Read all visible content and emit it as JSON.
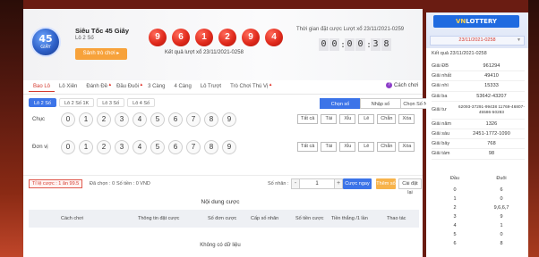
{
  "game": {
    "logo_number": "45",
    "logo_text": "GIÂY",
    "title": "Siêu Tốc 45 Giây",
    "subtitle": "Lô 2 Số",
    "rules_button": "Sảnh trò chơi ▸"
  },
  "result": {
    "balls": [
      "9",
      "6",
      "1",
      "2",
      "9",
      "4"
    ],
    "label": "Kết quả lượt xổ 23/11/2021-0258"
  },
  "countdown": {
    "label": "Thời gian đặt cược Lượt xổ 23/11/2021-0259",
    "h1": "0",
    "h2": "0",
    "m1": "0",
    "m2": "0",
    "s1": "3",
    "s2": "8"
  },
  "category_tabs": [
    {
      "label": "Bao Lô",
      "active": true,
      "hot": false
    },
    {
      "label": "Lô Xiên",
      "hot": false
    },
    {
      "label": "Đánh Đề",
      "hot": true
    },
    {
      "label": "Đầu Đuôi",
      "hot": true
    },
    {
      "label": "3 Càng",
      "hot": false
    },
    {
      "label": "4 Càng",
      "hot": false
    },
    {
      "label": "Lô Trượt",
      "hot": false
    },
    {
      "label": "Trò Chơi Thú Vị",
      "hot": true
    }
  ],
  "guide_label": "Cách chơi",
  "sub_tabs": [
    "Lô 2 Số",
    "Lô 2 Số 1K",
    "Lô 3 Số",
    "Lô 4 Số"
  ],
  "mode_tabs": [
    "Chọn số",
    "Nhập số",
    "Chọn Số Nhanh"
  ],
  "rows": [
    {
      "label": "Chục"
    },
    {
      "label": "Đơn vị"
    }
  ],
  "digits": [
    "0",
    "1",
    "2",
    "3",
    "4",
    "5",
    "6",
    "7",
    "8",
    "9"
  ],
  "quick_buttons": [
    "Tất cả",
    "Tài",
    "Xỉu",
    "Lẻ",
    "Chẵn",
    "Xóa"
  ],
  "bet": {
    "odds": "Tỉ lệ cược : 1 ăn 99.5",
    "count": "Đã chọn : 0",
    "money": "Số tiền : 0 VND",
    "multiplier_label": "Số nhân :",
    "minus": "-",
    "value": "1",
    "plus": "+",
    "fast_button": "Cược ngay",
    "add_button": "Thêm số",
    "reset_button": "Cài đặt lại"
  },
  "bet_table": {
    "title": "Nội dung cược",
    "columns": [
      "Cách chơi",
      "Thông tin đặt cược",
      "Số đơn cược",
      "Cấp số nhân",
      "Số tiền cược",
      "Tiền thắng /1 lần",
      "Thao tác"
    ],
    "empty": "Không có dữ liệu"
  },
  "side": {
    "brand_a": "VN",
    "brand_b": "LOTTERY",
    "date": "23/11/2021-0258",
    "result_label": "Kết quả 23/11/2021-0258",
    "prizes": [
      {
        "name": "Giải ĐB",
        "value": "961294"
      },
      {
        "name": "Giải nhất",
        "value": "49410"
      },
      {
        "name": "Giải nhì",
        "value": "15333"
      },
      {
        "name": "Giải ba",
        "value": "53642-43207"
      },
      {
        "name": "Giải tư",
        "value": "62093-37291-99438 11769-46807-45586-50283"
      },
      {
        "name": "Giải năm",
        "value": "1326"
      },
      {
        "name": "Giải sáu",
        "value": "2451-1772-1090"
      },
      {
        "name": "Giải bảy",
        "value": "768"
      },
      {
        "name": "Giải tám",
        "value": "98"
      }
    ],
    "dd_head": [
      "Đầu",
      "Đuôi"
    ],
    "dd_rows": [
      [
        "0",
        "6"
      ],
      [
        "1",
        "0"
      ],
      [
        "2",
        "9,6,6,7"
      ],
      [
        "3",
        "9"
      ],
      [
        "4",
        "1"
      ],
      [
        "5",
        "0"
      ],
      [
        "6",
        "8"
      ]
    ]
  },
  "colors": {
    "accent_blue": "#3c74e8",
    "ball_red": "#e02a1c",
    "orange": "#f7a23b"
  }
}
